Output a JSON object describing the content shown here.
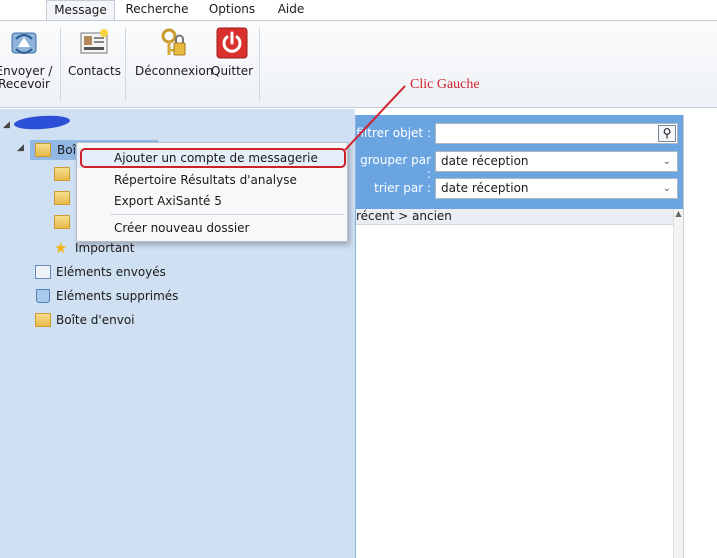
{
  "menu": {
    "tabs": [
      "Message",
      "Recherche",
      "Options",
      "Aide"
    ],
    "active_tab": "Message"
  },
  "ribbon": {
    "send_receive": "Envoyer / Recevoir",
    "contacts": "Contacts",
    "deconnexion": "Déconnexion",
    "quitter": "Quitter"
  },
  "tree": {
    "inbox_label": "Boîte",
    "important": "Important",
    "sent": "Eléments envoyés",
    "deleted": "Eléments supprimés",
    "outbox": "Boîte d'envoi"
  },
  "context_menu": {
    "items": [
      "Ajouter un compte de messagerie",
      "Répertoire Résultats d'analyse",
      "Export AxiSanté 5",
      "Créer nouveau dossier"
    ]
  },
  "filter": {
    "filter_label": "filtrer objet :",
    "filter_value": "",
    "group_label": "grouper par :",
    "group_value": "date réception",
    "sort_label": "trier par :",
    "sort_value": "date réception",
    "sort_order": "récent > ancien"
  },
  "annotation": {
    "text": "Clic Gauche",
    "color": "#d0202a"
  },
  "colors": {
    "tree_bg": "#cfe0f3",
    "filter_bg": "#6aa5e2",
    "quit_red": "#d9302b"
  }
}
